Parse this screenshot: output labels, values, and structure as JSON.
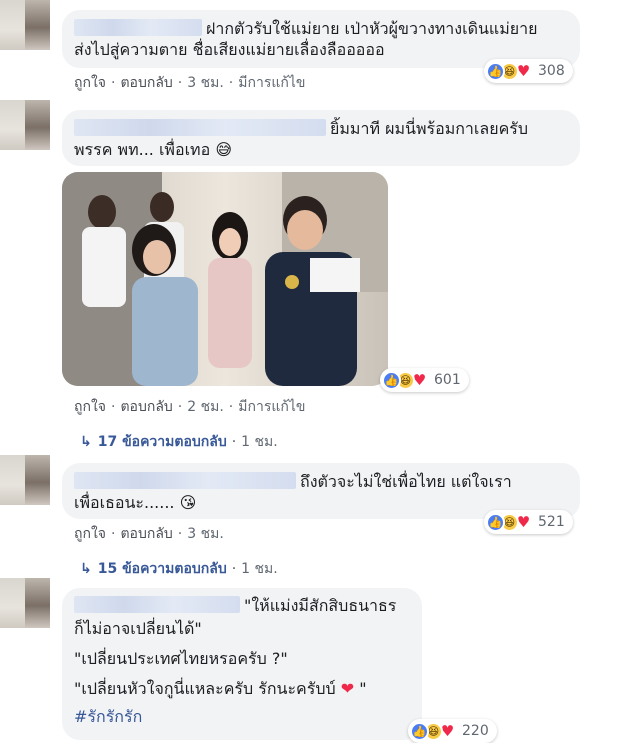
{
  "comments": [
    {
      "text_lines": [
        "ฝากตัวรับใช้แม่ยาย เป่าหัวผู้ขวางทางเดินแม่ยาย",
        "ส่งไปสู่ความตาย ชื่อเสียงแม่ยายเลื่องลือออออ"
      ],
      "actions": {
        "like": "ถูกใจ",
        "reply": "ตอบกลับ",
        "time": "3 ชม.",
        "edited": "มีการแก้ไข"
      },
      "reaction_count": "308"
    },
    {
      "text_lines": [
        "ยิ้มมาที ผมนี่พร้อมกาเลยครับ",
        "พรรค พท... เพื่อเทอ"
      ],
      "emoji": "😅",
      "actions": {
        "like": "ถูกใจ",
        "reply": "ตอบกลับ",
        "time": "2 ชม.",
        "edited": "มีการแก้ไข"
      },
      "reaction_count": "601",
      "replies": {
        "label": "17 ข้อความตอบกลับ",
        "time": "1 ชม."
      }
    },
    {
      "text_lines": [
        "ถึงตัวจะไม่ใช่เพื่อไทย แต่ใจเรา",
        "เพื่อเธอนะ......"
      ],
      "emoji": "😘",
      "actions": {
        "like": "ถูกใจ",
        "reply": "ตอบกลับ",
        "time": "3 ชม."
      },
      "reaction_count": "521",
      "replies": {
        "label": "15 ข้อความตอบกลับ",
        "time": "1 ชม."
      }
    },
    {
      "text_lines": [
        "\"ให้แม่งมีสักสิบธนาธร",
        "ก็ไม่อาจเปลี่ยนได้\"",
        "\"เปลี่ยนประเทศไทยหรอครับ ?\"",
        "\"เปลี่ยนหัวใจกูนี่แหละครับ รักนะครับบ์",
        "\""
      ],
      "emoji": "❤",
      "hashtag": "#รักรักรัก",
      "reaction_count": "220"
    }
  ],
  "icons": [
    "like-icon",
    "haha-icon",
    "love-icon",
    "reply-arrow-icon"
  ],
  "colors": {
    "bubble": "#f2f3f5",
    "link": "#385898",
    "like": "#4a7cf3",
    "love": "#f0284a"
  }
}
